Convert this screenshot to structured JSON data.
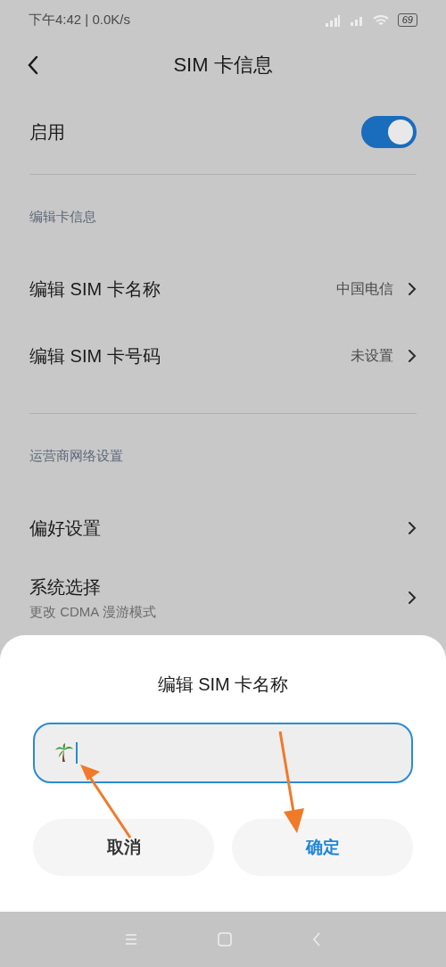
{
  "status_bar": {
    "time": "下午4:42 | 0.0K/s",
    "battery": "69"
  },
  "header": {
    "title": "SIM 卡信息"
  },
  "enable": {
    "label": "启用",
    "on": true
  },
  "sections": [
    {
      "title": "编辑卡信息",
      "rows": [
        {
          "label": "编辑 SIM 卡名称",
          "value": "中国电信"
        },
        {
          "label": "编辑 SIM 卡号码",
          "value": "未设置"
        }
      ]
    },
    {
      "title": "运营商网络设置",
      "rows": [
        {
          "label": "偏好设置"
        },
        {
          "label": "系统选择",
          "subtitle": "更改 CDMA 漫游模式"
        }
      ]
    }
  ],
  "dialog": {
    "title": "编辑 SIM 卡名称",
    "buttons": [
      {
        "label": "取消",
        "kind": "cancel"
      },
      {
        "label": "确定",
        "kind": "confirm"
      }
    ]
  }
}
